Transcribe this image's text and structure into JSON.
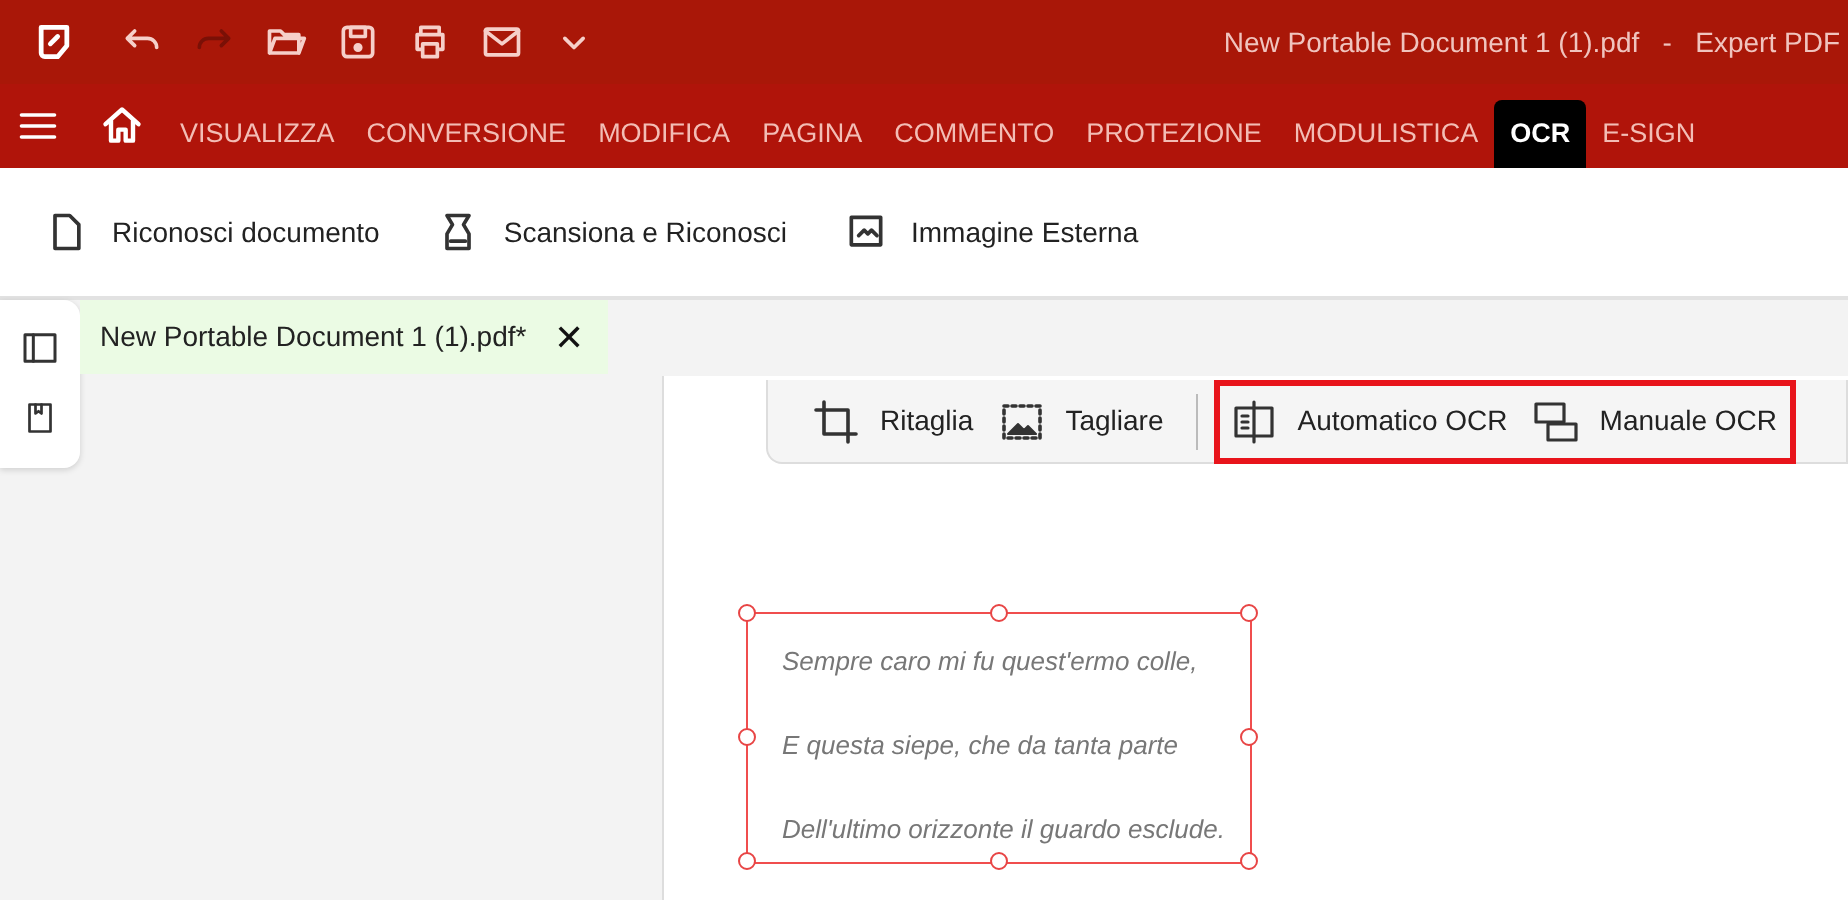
{
  "window": {
    "title": "New Portable Document 1 (1).pdf   -   Expert PDF"
  },
  "menu_tabs": [
    {
      "label": "VISUALIZZA",
      "selected": false
    },
    {
      "label": "CONVERSIONE",
      "selected": false
    },
    {
      "label": "MODIFICA",
      "selected": false
    },
    {
      "label": "PAGINA",
      "selected": false
    },
    {
      "label": "COMMENTO",
      "selected": false
    },
    {
      "label": "PROTEZIONE",
      "selected": false
    },
    {
      "label": "MODULISTICA",
      "selected": false
    },
    {
      "label": "OCR",
      "selected": true
    },
    {
      "label": "E-SIGN",
      "selected": false
    }
  ],
  "ribbon": [
    {
      "kind": "document",
      "label": "Riconosci documento"
    },
    {
      "kind": "scanner",
      "label": "Scansiona e Riconosci"
    },
    {
      "kind": "image",
      "label": "Immagine Esterna"
    }
  ],
  "document_tab": {
    "label": "New Portable Document 1 (1).pdf*",
    "close": "✕"
  },
  "toolbar_groups": [
    {
      "highlighted": false,
      "tools": [
        {
          "kind": "crop",
          "label": "Ritaglia"
        },
        {
          "kind": "cut",
          "label": "Tagliare"
        }
      ]
    },
    {
      "highlighted": true,
      "tools": [
        {
          "kind": "auto",
          "label": "Automatico OCR"
        },
        {
          "kind": "manual",
          "label": "Manuale OCR"
        }
      ]
    }
  ],
  "selection": {
    "lines": [
      "Sempre caro mi fu quest'ermo colle,",
      "E questa siepe, che da tanta parte",
      "Dell'ultimo orizzonte il guardo esclude."
    ]
  }
}
